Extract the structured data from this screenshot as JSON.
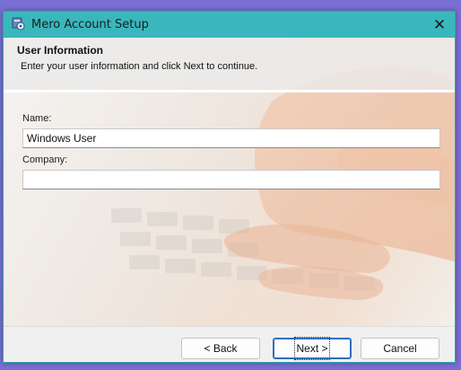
{
  "window": {
    "title": "Mero Account Setup",
    "close_glyph": "✕"
  },
  "header": {
    "title": "User Information",
    "description": "Enter your user information and click  Next to continue."
  },
  "form": {
    "name_label": "Name:",
    "name_value": "Windows User",
    "company_label": "Company:",
    "company_value": ""
  },
  "buttons": {
    "back": "< Back",
    "next": "Next >",
    "cancel": "Cancel"
  },
  "colors": {
    "titlebar": "#39b7bc",
    "desktop": "#7a6fd3",
    "primary_border": "#2f6fbf"
  },
  "icons": {
    "app": "installer-icon",
    "close": "close-icon"
  }
}
